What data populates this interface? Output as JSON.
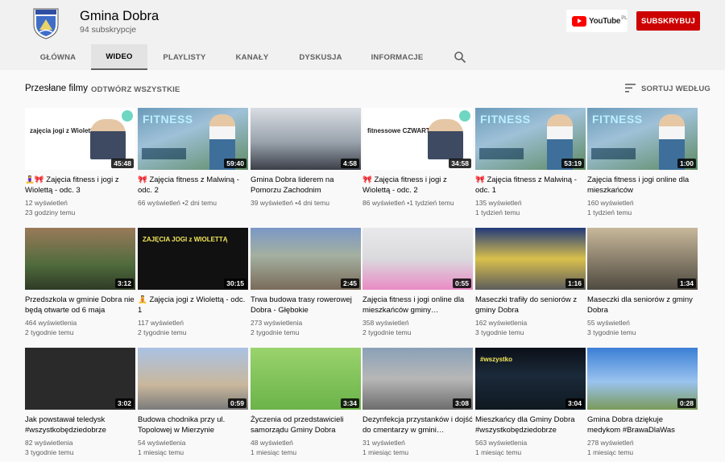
{
  "channel": {
    "name": "Gmina Dobra",
    "subscribers": "94 subskrypcje"
  },
  "youtube_badge": {
    "word": "YouTube",
    "region": "PL"
  },
  "subscribe_label": "SUBSKRYBUJ",
  "tabs": [
    "GŁÓWNA",
    "WIDEO",
    "PLAYLISTY",
    "KANAŁY",
    "DYSKUSJA",
    "INFORMACJE"
  ],
  "active_tab": "WIDEO",
  "section": {
    "title": "Przesłane filmy",
    "play_all": "ODTWÓRZ WSZYSTKIE",
    "sort": "SORTUJ WEDŁUG"
  },
  "videos": [
    {
      "title": "🧘‍♀️🎀 Zajęcia fitness i jogi z Wiolettą - odc. 3",
      "views": "12 wyświetleń",
      "age": "23 godziny temu",
      "duration": "45:48",
      "thumb_text": "zajęcia jogi z Wiolettą"
    },
    {
      "title": "🎀 Zajęcia fitness z Malwiną - odc. 2",
      "views": "66 wyświetleń",
      "age": "2 dni temu",
      "duration": "59:40",
      "thumb_text": "FITNESS"
    },
    {
      "title": "Gmina Dobra liderem na Pomorzu Zachodnim",
      "views": "39 wyświetleń",
      "age": "4 dni temu",
      "duration": "4:58"
    },
    {
      "title": "🎀 Zajęcia fitness i jogi z Wiolettą - odc. 2",
      "views": "86 wyświetleń",
      "age": "1 tydzień temu",
      "duration": "34:58",
      "thumb_text": "fitnessowe CZWARTKI"
    },
    {
      "title": "🎀 Zajęcia fitness z Malwiną - odc. 1",
      "views": "135 wyświetleń",
      "age": "1 tydzień temu",
      "duration": "53:19",
      "thumb_text": "FITNESS"
    },
    {
      "title": "Zajęcia fitness i jogi online dla mieszkańców",
      "views": "160 wyświetleń",
      "age": "1 tydzień temu",
      "duration": "1:00",
      "thumb_text": "FITNESS"
    },
    {
      "title": "Przedszkola w gminie Dobra nie będą otwarte od 6 maja",
      "views": "464 wyświetlenia",
      "age": "2 tygodnie temu",
      "duration": "3:12"
    },
    {
      "title": "🧘 Zajęcia jogi z Wiolettą - odc. 1",
      "views": "117 wyświetleń",
      "age": "2 tygodnie temu",
      "duration": "30:15",
      "thumb_text": "ZAJĘCIA JOGI z WIOLETTĄ"
    },
    {
      "title": "Trwa budowa trasy rowerowej Dobra - Głębokie",
      "views": "273 wyświetlenia",
      "age": "2 tygodnie temu",
      "duration": "2:45"
    },
    {
      "title": "Zajęcia fitness i jogi online dla mieszkańców gminy…",
      "views": "358 wyświetleń",
      "age": "2 tygodnie temu",
      "duration": "0:55"
    },
    {
      "title": "Maseczki trafiły do seniorów z gminy Dobra",
      "views": "162 wyświetlenia",
      "age": "3 tygodnie temu",
      "duration": "1:16"
    },
    {
      "title": "Maseczki dla seniorów z gminy Dobra",
      "views": "55 wyświetleń",
      "age": "3 tygodnie temu",
      "duration": "1:34"
    },
    {
      "title": "Jak powstawał teledysk #wszystkobędziedobrze",
      "views": "82 wyświetlenia",
      "age": "3 tygodnie temu",
      "duration": "3:02"
    },
    {
      "title": "Budowa chodnika przy ul. Topolowej w Mierzynie",
      "views": "54 wyświetlenia",
      "age": "1 miesiąc temu",
      "duration": "0:59"
    },
    {
      "title": "Życzenia od przedstawicieli samorządu Gminy Dobra",
      "views": "48 wyświetleń",
      "age": "1 miesiąc temu",
      "duration": "3:34"
    },
    {
      "title": "Dezynfekcja przystanków i dojść do cmentarzy w gmini…",
      "views": "31 wyświetleń",
      "age": "1 miesiąc temu",
      "duration": "3:08"
    },
    {
      "title": "Mieszkańcy dla Gminy Dobra #wszystkobędziedobrze",
      "views": "563 wyświetlenia",
      "age": "1 miesiąc temu",
      "duration": "3:04",
      "thumb_text": "#wszystko"
    },
    {
      "title": "Gmina Dobra dziękuje medykom #BrawaDlaWas",
      "views": "278 wyświetleń",
      "age": "1 miesiąc temu",
      "duration": "0:28"
    }
  ],
  "colors": {
    "header_bg": "#f1f1f1",
    "page_bg": "#f9f9f9",
    "subscribe_red": "#cc0000",
    "text_secondary": "#606060"
  },
  "icons": {
    "search": "search-icon",
    "sort": "sort-icon",
    "crest": "channel-crest-icon"
  }
}
